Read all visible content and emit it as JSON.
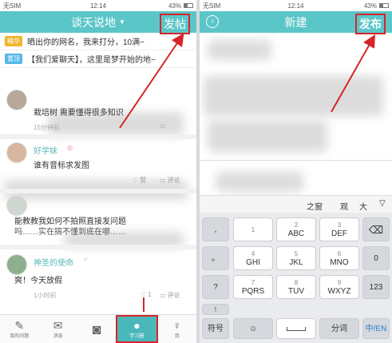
{
  "left": {
    "status": {
      "carrier": "无SIM",
      "time": "12:14",
      "battery": "43%"
    },
    "title": "谈天说地",
    "post_button": "发帖",
    "pinned": [
      {
        "tag": "精华",
        "tag_color": "#f0b429",
        "text": "晒出你的网名，我来打分，10满~"
      },
      {
        "tag": "置顶",
        "tag_color": "#52b6e8",
        "text": "【我们爱聊天】，这里是梦开始的地~"
      }
    ],
    "posts": [
      {
        "text": "栽培树  需要懂得很多知识",
        "time": "15分钟前"
      },
      {
        "user": "好学妹",
        "text": "谁有音标求发图",
        "like": "赞",
        "comment": "评论"
      },
      {
        "text": "能教教我如何不拍照直接发问题",
        "text2": "吗……实在搞不懂到底在哪……"
      },
      {
        "user": "神圣的使命",
        "text": "爽！今天放假",
        "time": "1小时前",
        "likes": "1",
        "comment": "评论"
      }
    ],
    "tabs": [
      {
        "label": "我的问题",
        "icon": "pencil-icon"
      },
      {
        "label": "消息",
        "icon": "envelope-icon"
      },
      {
        "label": "",
        "icon": "camera-icon"
      },
      {
        "label": "学习圈",
        "icon": "people-icon"
      },
      {
        "label": "我",
        "icon": "person-icon"
      }
    ]
  },
  "right": {
    "status": {
      "carrier": "无SIM",
      "time": "12:14",
      "battery": "43%"
    },
    "title": "新建",
    "publish_button": "发布",
    "candidates": [
      "之窗",
      "观",
      "大"
    ],
    "keys": {
      "left_col": [
        ",",
        "。",
        "?",
        "!"
      ],
      "row1": [
        {
          "num": "1",
          "letters": ""
        },
        {
          "num": "2",
          "letters": "ABC"
        },
        {
          "num": "3",
          "letters": "DEF"
        }
      ],
      "row2": [
        {
          "num": "4",
          "letters": "GHI"
        },
        {
          "num": "5",
          "letters": "JKL"
        },
        {
          "num": "6",
          "letters": "MNO"
        }
      ],
      "row3": [
        {
          "num": "7",
          "letters": "PQRS"
        },
        {
          "num": "8",
          "letters": "TUV"
        },
        {
          "num": "9",
          "letters": "WXYZ"
        }
      ],
      "right_col": [
        "⌫",
        "0",
        "123"
      ],
      "bottom": [
        "符号",
        "☺",
        "",
        "分词",
        "中/EN"
      ]
    }
  },
  "colors": {
    "accent": "#5bc6c8",
    "highlight": "#d6252a"
  }
}
